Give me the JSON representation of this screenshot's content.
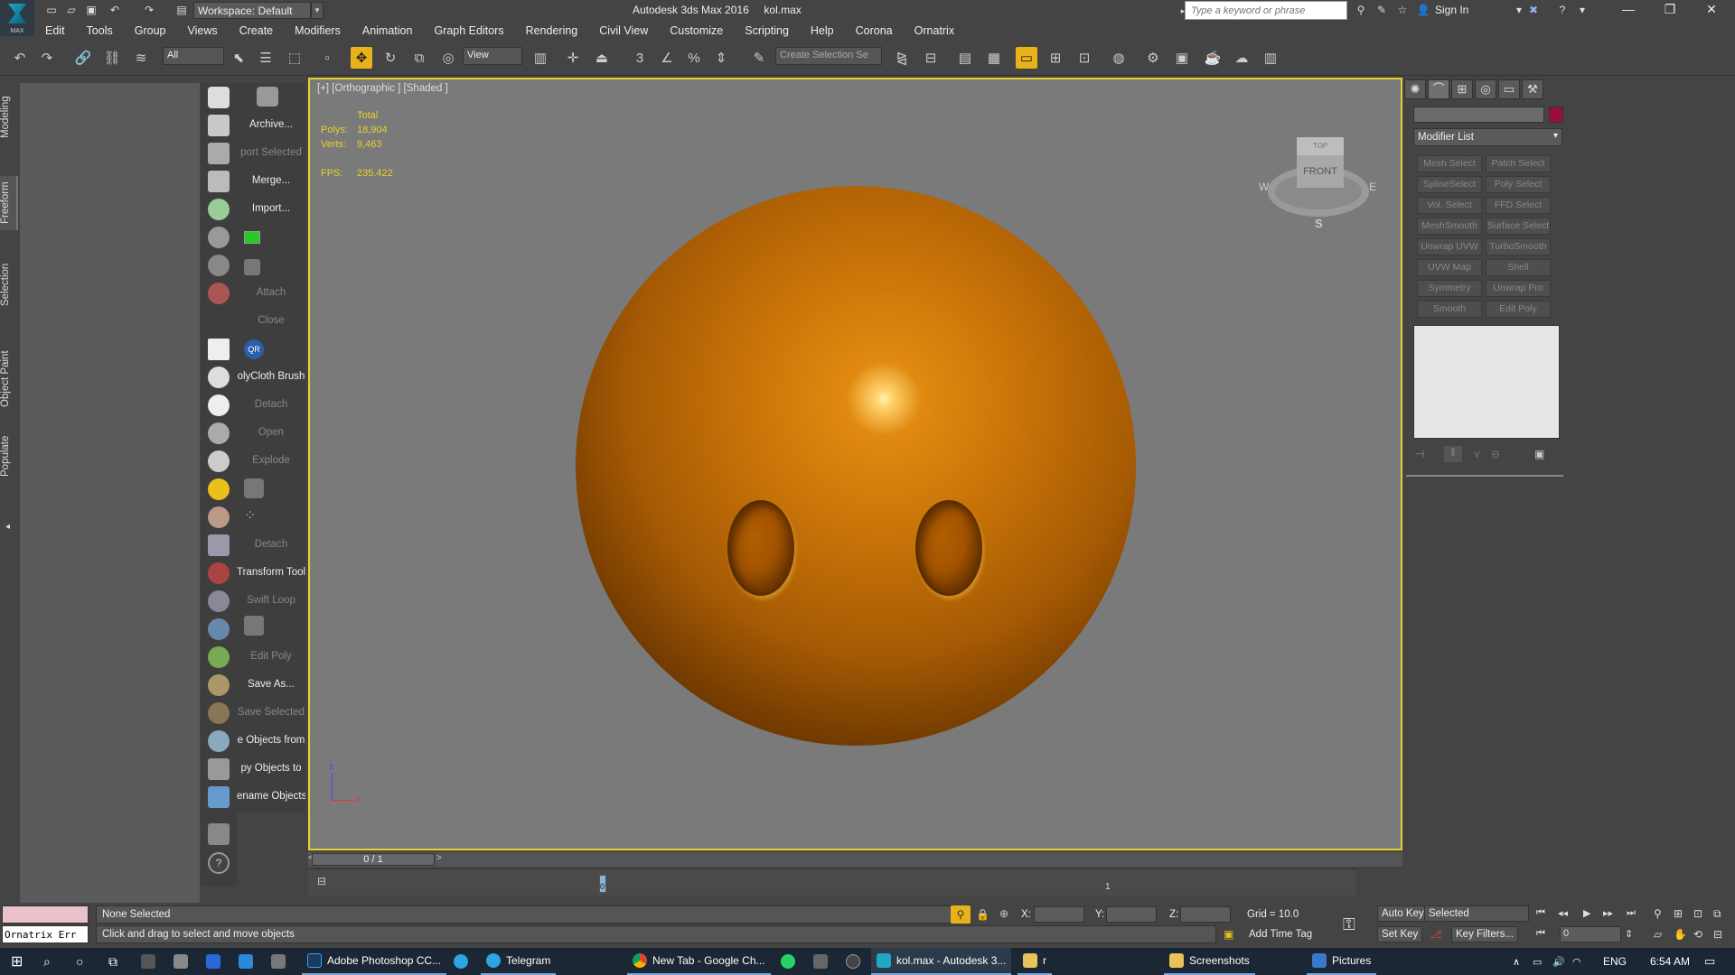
{
  "title_bar": {
    "app_title": "Autodesk 3ds Max 2016",
    "file_name": "kol.max",
    "logo_label": "MAX",
    "workspace_label": "Workspace: Default",
    "search_placeholder": "Type a keyword or phrase",
    "sign_in": "Sign In"
  },
  "menu": [
    "Edit",
    "Tools",
    "Group",
    "Views",
    "Create",
    "Modifiers",
    "Animation",
    "Graph Editors",
    "Rendering",
    "Civil View",
    "Customize",
    "Scripting",
    "Help",
    "Corona",
    "Ornatrix"
  ],
  "toolbar": {
    "selection_filter": "All",
    "reference_coord": "View",
    "named_selection": "Create Selection Se"
  },
  "ribbon_tabs": [
    "Modeling",
    "Freeform",
    "Selection",
    "Object Paint",
    "Populate"
  ],
  "commands": [
    {
      "label": "Archive...",
      "enabled": true
    },
    {
      "label": "port Selected",
      "enabled": false
    },
    {
      "label": "Merge...",
      "enabled": true
    },
    {
      "label": "Import...",
      "enabled": true
    },
    {
      "label": "Attach",
      "enabled": false
    },
    {
      "label": "Close",
      "enabled": false
    },
    {
      "label": "olyCloth Brush",
      "enabled": true
    },
    {
      "label": "Detach",
      "enabled": false
    },
    {
      "label": "Open",
      "enabled": false
    },
    {
      "label": "Explode",
      "enabled": false
    },
    {
      "label": "Detach",
      "enabled": false
    },
    {
      "label": "Transform Tool",
      "enabled": true
    },
    {
      "label": "Swift Loop",
      "enabled": false
    },
    {
      "label": "Edit Poly",
      "enabled": false
    },
    {
      "label": "Save As...",
      "enabled": true
    },
    {
      "label": "Save Selected",
      "enabled": false
    },
    {
      "label": "e Objects from",
      "enabled": true
    },
    {
      "label": "py Objects to",
      "enabled": true
    },
    {
      "label": "ename Objects",
      "enabled": true
    }
  ],
  "viewport": {
    "label": "[+] [Orthographic ] [Shaded ]",
    "stats": {
      "total_label": "Total",
      "polys_label": "Polys:",
      "polys_value": "18,904",
      "verts_label": "Verts:",
      "verts_value": "9,463",
      "fps_label": "FPS:",
      "fps_value": "235.422"
    },
    "viewcube": {
      "top": "TOP",
      "front": "FRONT",
      "w": "W",
      "e": "E",
      "s": "S"
    },
    "axis": {
      "z": "z",
      "x": "x"
    },
    "object_color": "#c77308"
  },
  "timeline": {
    "frame_counter": "0 / 1",
    "marker_0": "0",
    "marker_1": "1"
  },
  "command_panel": {
    "modifier_list": "Modifier List",
    "object_color": "#9a0f3a",
    "modifier_buttons": [
      "Mesh Select",
      "Patch Select",
      "SplineSelect",
      "Poly Select",
      "Vol. Select",
      "FFD Select",
      "MeshSmooth",
      "Surface Select",
      "Unwrap UVW",
      "TurboSmooth",
      "UVW Map",
      "Shell",
      "Symmetry",
      "Unwrap Pro",
      "Smooth",
      "Edit Poly"
    ]
  },
  "status": {
    "listener_text": "Ornatrix Err",
    "selection_info": "None Selected",
    "prompt": "Click and drag to select and move objects",
    "x_label": "X:",
    "y_label": "Y:",
    "z_label": "Z:",
    "grid": "Grid = 10.0",
    "add_time_tag": "Add Time Tag",
    "auto_key": "Auto Key",
    "set_key": "Set Key",
    "selected_dropdown": "Selected",
    "key_filters": "Key Filters...",
    "frame_value": "0"
  },
  "taskbar": {
    "items": [
      {
        "label": "Adobe Photoshop CC...",
        "color": "#2fa3f7"
      },
      {
        "label": "Telegram",
        "color": "#2ca5e0"
      },
      {
        "label": "New Tab - Google Ch...",
        "color": "#e8b21a"
      },
      {
        "label": "kol.max - Autodesk 3...",
        "color": "#1fa7c4"
      },
      {
        "label": "r",
        "color": "#e8c25a"
      },
      {
        "label": "Screenshots",
        "color": "#e8c25a"
      },
      {
        "label": "Pictures",
        "color": "#3a78c8"
      }
    ],
    "language": "ENG",
    "time": "6:54 AM"
  }
}
